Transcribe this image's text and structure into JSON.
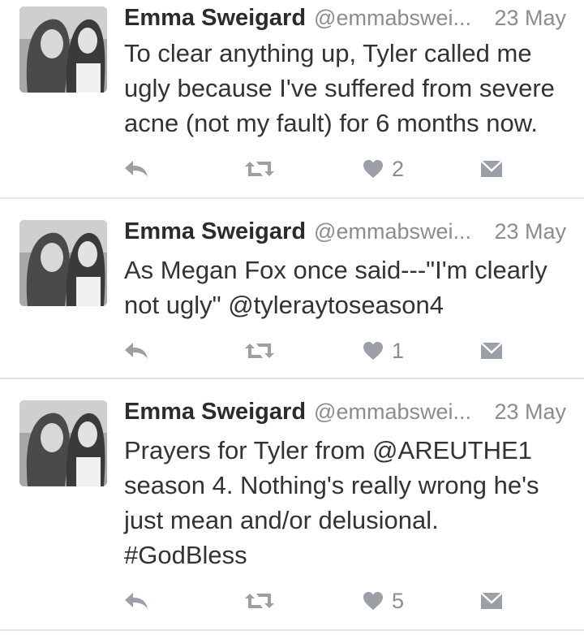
{
  "colors": {
    "icon": "#9aa0a6",
    "text": "#333333",
    "meta": "#8c8c8c",
    "divider": "#e4e4e4"
  },
  "tweets": [
    {
      "name": "Emma Sweigard",
      "handle": "@emmabswei...",
      "date": "23 May",
      "text": "To clear anything up, Tyler called me ugly because I've suffered from severe acne (not my fault) for 6 months now.",
      "likes": "2"
    },
    {
      "name": "Emma Sweigard",
      "handle": "@emmabswei...",
      "date": "23 May",
      "text": "As Megan Fox once said---\"I'm clearly not ugly\" @tyleraytoseason4",
      "likes": "1"
    },
    {
      "name": "Emma Sweigard",
      "handle": "@emmabswei...",
      "date": "23 May",
      "text": "Prayers for Tyler from @AREUTHE1 season 4. Nothing's really wrong he's just mean and/or delusional. #GodBless",
      "likes": "5"
    }
  ]
}
